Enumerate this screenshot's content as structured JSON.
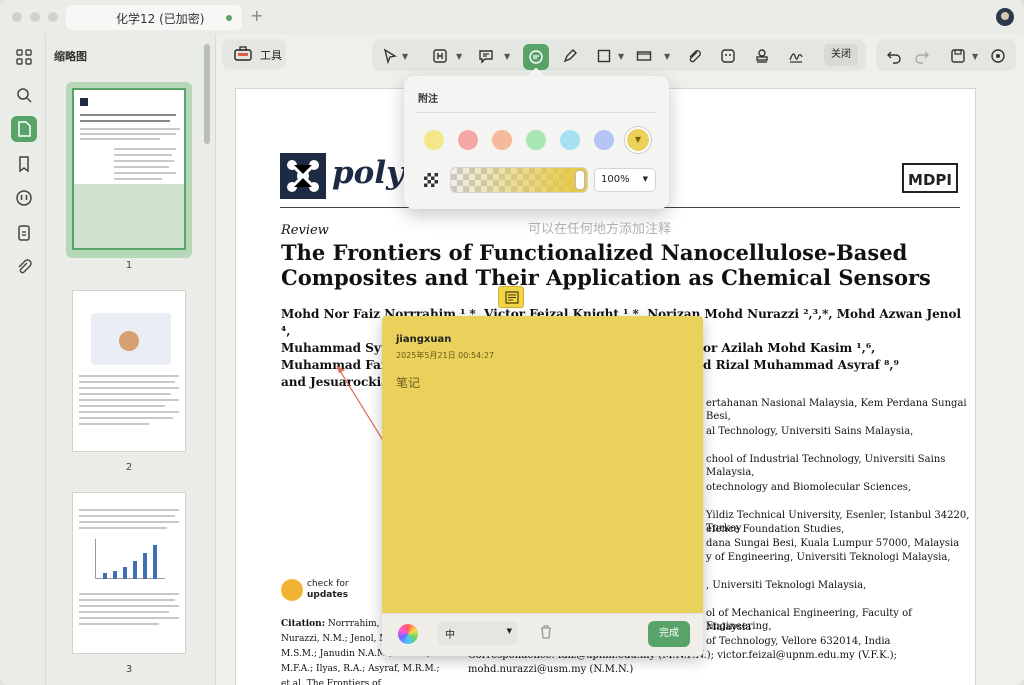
{
  "titlebar": {
    "tab_label": "化学12 (已加密)",
    "new_tab_icon": "+"
  },
  "rail": {
    "icons": [
      "grid-icon",
      "search-icon",
      "page-icon",
      "bookmark-icon",
      "annotation-icon",
      "document-icon",
      "attachment-icon"
    ]
  },
  "thumbnails": {
    "title": "缩略图",
    "pages": [
      {
        "num": "1"
      },
      {
        "num": "2"
      },
      {
        "num": "3"
      }
    ]
  },
  "toolbar": {
    "tools_label": "工具",
    "close_label": "关闭"
  },
  "popover": {
    "title": "附注",
    "swatches": [
      "#f6e78b",
      "#f5a7a7",
      "#f5b99b",
      "#a8e6b3",
      "#a6e0f2",
      "#b3c4f5",
      "#ead15a"
    ],
    "opacity_value": "100%"
  },
  "document": {
    "logo_text": "polym",
    "publisher": "MDPI",
    "hint": "可以在任何地方添加注释",
    "review_label": "Review",
    "title": "The Frontiers of Functionalized Nanocellulose-Based Composites and Their Application as Chemical Sensors",
    "authors_line1": "Mohd Nor Faiz Norrrahim ¹,*, Victor Feizal Knight ¹,*, Norizan Mohd Nurazzi ²,³,*, Mohd Azwan Jenol ⁴,",
    "authors_line2": "Muhammad Syuk",
    "authors_line2b": "or Azilah Mohd Kasim ¹,⁶,",
    "authors_line3": "Muhammad Faiza",
    "authors_line3b": "d Rizal Muhammad Asyraf ⁸,⁹",
    "authors_line4": "and Jesuarockiam",
    "affiliations": [
      "ertahanan Nasional Malaysia, Kem Perdana Sungai Besi,",
      "al Technology, Universiti Sains Malaysia,",
      "chool of Industrial Technology, Universiti Sains Malaysia,",
      "otechnology and Biomolecular Sciences,",
      "Yildiz Technical University, Esenler, Istanbul 34220, Turkey",
      "efence Foundation Studies,",
      "dana Sungai Besi, Kuala Lumpur 57000, Malaysia",
      "y of Engineering, Universiti Teknologi Malaysia,",
      ", Universiti Teknologi Malaysia,",
      "ol of Mechanical Engineering, Faculty of Engineering,",
      "Malaysia",
      "of Technology, Vellore 632014, India"
    ],
    "check_updates_l1": "check for",
    "check_updates_l2": "updates",
    "citation_label": "Citation:",
    "citation_text": "Norrrahim, M.N V.F.; Nurazzi, N.M.; Jenol, Misenan, M.S.M.; Janudin N.A.M.; Shukor, M.F.A.; Ilyas, R.A.; Asyraf, M.R.M.; et al. The Frontiers of",
    "email_line1": "Correspondence: faiz@upnm.edu.my (M.N.F.N.); victor.feizal@upnm.edu.my (V.F.K.);",
    "email_line2": "mohd.nurazzi@usm.my (N.M.N.)"
  },
  "sticky_note": {
    "user": "jiangxuan",
    "timestamp": "2025年5月21日 00:54:27",
    "body": "笔记",
    "font_size_value": "中",
    "done_label": "完成",
    "color": "#e9d15b"
  }
}
